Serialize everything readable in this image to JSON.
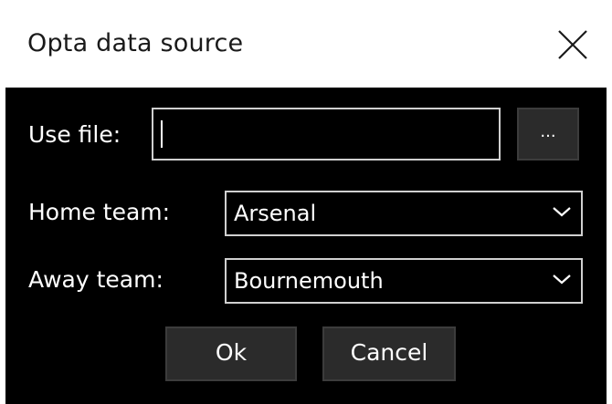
{
  "window": {
    "title": "Opta data source",
    "close_icon": "close-icon"
  },
  "form": {
    "file": {
      "label": "Use file:",
      "value": "",
      "browse_label": "..."
    },
    "home_team": {
      "label": "Home team:",
      "selected": "Arsenal"
    },
    "away_team": {
      "label": "Away team:",
      "selected": "Bournemouth"
    }
  },
  "buttons": {
    "ok_label": "Ok",
    "cancel_label": "Cancel"
  },
  "colors": {
    "background": "#000000",
    "text": "#ffffff",
    "titlebar": "#ffffff",
    "button_bg": "#2b2b2b",
    "input_border": "#d0d0d0"
  }
}
